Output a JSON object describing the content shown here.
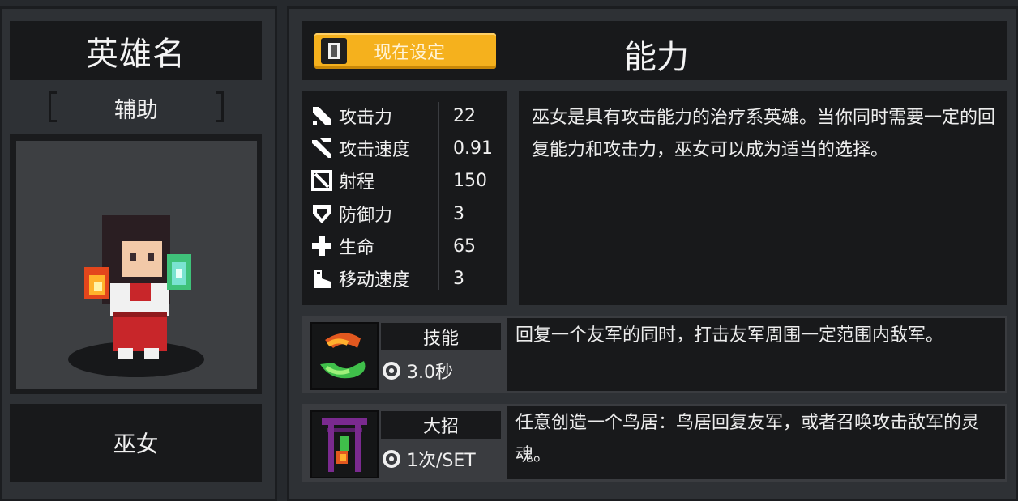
{
  "hero": {
    "name_header": "英雄名",
    "role": "辅助",
    "class_name": "巫女"
  },
  "header": {
    "set_button_label": "现在设定",
    "title": "能力"
  },
  "stats": [
    {
      "icon": "sword-icon",
      "label": "攻击力",
      "value": "22"
    },
    {
      "icon": "double-sword-icon",
      "label": "攻击速度",
      "value": "0.91"
    },
    {
      "icon": "bow-icon",
      "label": "射程",
      "value": "150"
    },
    {
      "icon": "shield-icon",
      "label": "防御力",
      "value": "3"
    },
    {
      "icon": "cross-icon",
      "label": "生命",
      "value": "65"
    },
    {
      "icon": "boot-icon",
      "label": "移动速度",
      "value": "3"
    }
  ],
  "description": "巫女是具有攻击能力的治疗系英雄。当你同时需要一定的回复能力和攻击力，巫女可以成为适当的选择。",
  "skill": {
    "name": "技能",
    "cooldown": "3.0秒",
    "description": "回复一个友军的同时，打击友军周围一定范围内敌军。"
  },
  "ultimate": {
    "name": "大招",
    "cooldown": "1次/SET",
    "description": "任意创造一个鸟居：鸟居回复友军，或者召唤攻击敌军的灵魂。"
  },
  "colors": {
    "accent": "#f5b11d",
    "panel_dark": "#18191b",
    "panel_mid": "#3a3c40",
    "background": "#26292d"
  }
}
